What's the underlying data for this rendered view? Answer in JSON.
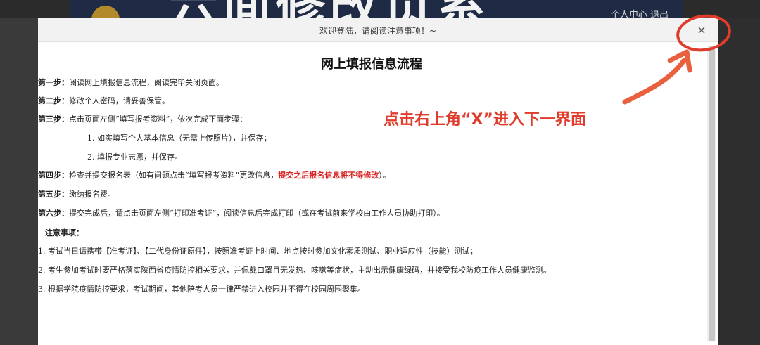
{
  "background": {
    "header_text": "六面修改页系",
    "links": "个人中心  退出"
  },
  "modal": {
    "title": "欢迎登陆，请阅读注意事项！~",
    "close": "×"
  },
  "document": {
    "title": "网上填报信息流程",
    "steps": [
      {
        "label": "第一步：",
        "text": "阅读网上填报信息流程，阅读完毕关闭页面。"
      },
      {
        "label": "第二步：",
        "text": "修改个人密码，请妥善保管。"
      },
      {
        "label": "第三步：",
        "text": "点击页面左侧“填写报考资料”，依次完成下面步骤："
      },
      {
        "label": "第四步：",
        "text": "检查并提交报名表（如有问题点击“填写报考资料”更改信息，",
        "highlight": "提交之后报名信息将不得修改",
        "tail": "）。"
      },
      {
        "label": "第五步：",
        "text": "缴纳报名费。"
      },
      {
        "label": "第六步：",
        "text": "提交完成后，请点击页面左侧“打印准考证”，阅读信息后完成打印（或在考试前来学校由工作人员协助打印）。"
      }
    ],
    "substeps": [
      "1. 如实填写个人基本信息（无需上传照片），并保存；",
      "2. 填报专业志愿，并保存。"
    ],
    "notes_title": "注意事项：",
    "notes": [
      "1. 考试当日请携带【准考证】、【二代身份证原件】，按照准考证上时间、地点按时参加文化素质测试、职业适应性（技能）测试；",
      "2. 考生参加考试时要严格落实陕西省疫情防控相关要求，并佩戴口罩且无发热、咳嗽等症状，主动出示健康绿码，并接受我校防疫工作人员健康监测。",
      "3. 根据学院疫情防控要求，考试期间，其他陪考人员一律严禁进入校园并不得在校园周围聚集。"
    ]
  },
  "annotation": {
    "text": "点击右上角“X”进入下一界面",
    "color": "#e03c2c"
  }
}
